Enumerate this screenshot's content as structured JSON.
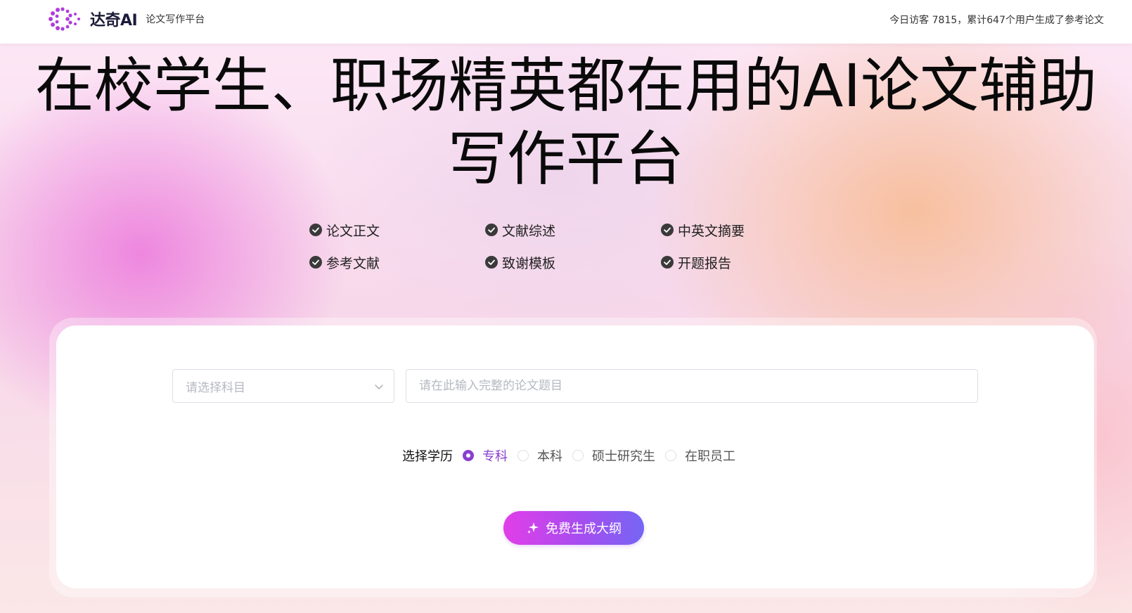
{
  "header": {
    "brand_name": "达奇AI",
    "brand_tagline": "论文写作平台",
    "visitor_stats": "今日访客 7815，累计647个用户生成了参考论文",
    "logo_icon": "brand-logo-icon"
  },
  "hero": {
    "title_line1": "在校学生、职场精英都在用的AI论文辅助",
    "title_line2": "写作平台",
    "features": [
      {
        "label": "论文正文",
        "icon": "check-circle-icon"
      },
      {
        "label": "文献综述",
        "icon": "check-circle-icon"
      },
      {
        "label": "中英文摘要",
        "icon": "check-circle-icon"
      },
      {
        "label": "参考文献",
        "icon": "check-circle-icon"
      },
      {
        "label": "致谢模板",
        "icon": "check-circle-icon"
      },
      {
        "label": "开题报告",
        "icon": "check-circle-icon"
      }
    ]
  },
  "form": {
    "subject_select": {
      "placeholder": "请选择科目",
      "value": ""
    },
    "title_input": {
      "placeholder": "请在此输入完整的论文题目",
      "value": ""
    },
    "education": {
      "label": "选择学历",
      "options": [
        {
          "label": "专科",
          "selected": true
        },
        {
          "label": "本科",
          "selected": false
        },
        {
          "label": "硕士研究生",
          "selected": false
        },
        {
          "label": "在职员工",
          "selected": false
        }
      ]
    },
    "generate_button_label": "免费生成大纲"
  },
  "colors": {
    "accent": "#8a3fd1",
    "button_gradient_start": "#e13ee8",
    "button_gradient_end": "#7566f4",
    "check_icon": "#3a3a3a"
  }
}
